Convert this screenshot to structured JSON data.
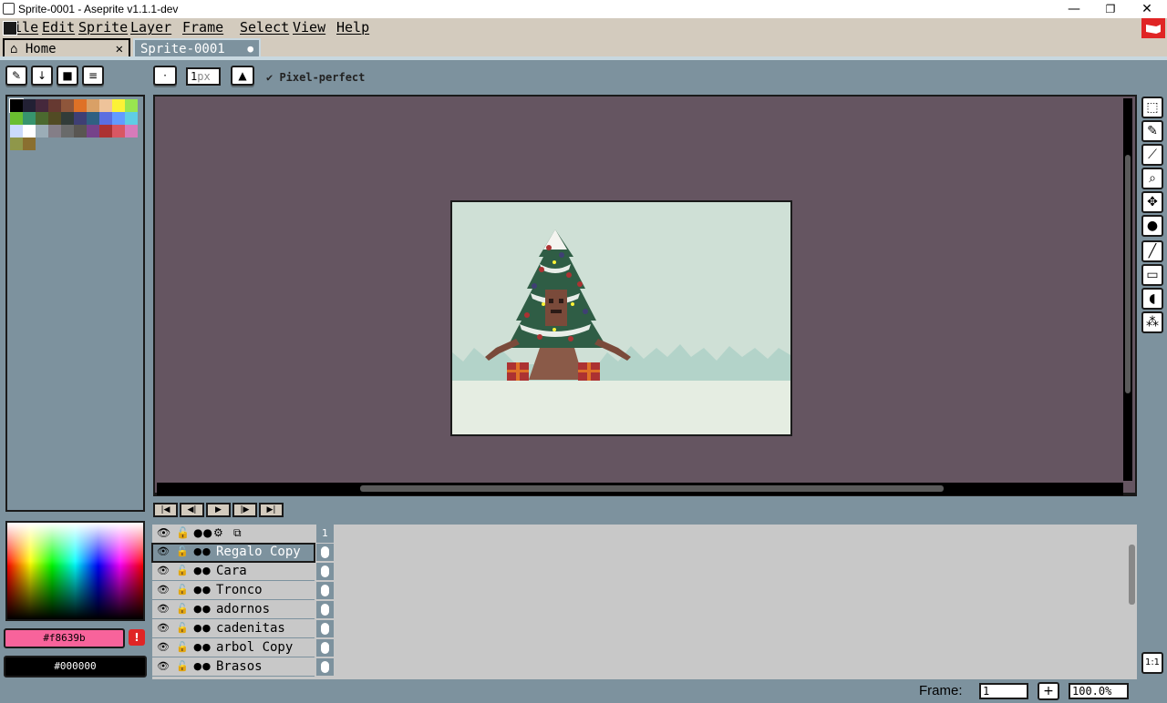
{
  "window": {
    "title": "Sprite-0001 - Aseprite v1.1.1-dev",
    "minimize": "—",
    "restore": "❐",
    "close": "✕"
  },
  "menubar": {
    "items": [
      {
        "label": "File"
      },
      {
        "label": "Edit"
      },
      {
        "label": "Sprite"
      },
      {
        "label": "Layer"
      },
      {
        "label": "Frame"
      },
      {
        "label": "Select"
      },
      {
        "label": "View"
      },
      {
        "label": "Help"
      }
    ]
  },
  "tabs": [
    {
      "label": "Home",
      "icon": "home-icon",
      "close_glyph": "✕"
    },
    {
      "label": "Sprite-0001",
      "modified_glyph": "●"
    }
  ],
  "context_bar": {
    "brush_size_value": "1",
    "brush_size_unit": "px",
    "pixel_perfect_label": "Pixel-perfect",
    "pixel_perfect_checked": true
  },
  "palette": {
    "colors": [
      "#000000",
      "#222034",
      "#45283c",
      "#663931",
      "#8f563b",
      "#df7126",
      "#d9a066",
      "#eec39a",
      "#fbf236",
      "#99e550",
      "#6abe30",
      "#37946e",
      "#4b692f",
      "#524b24",
      "#323c39",
      "#3f3f74",
      "#306082",
      "#5b6ee1",
      "#639bff",
      "#5fcde4",
      "#cbdbfc",
      "#ffffff",
      "#9badb7",
      "#847e87",
      "#696a6a",
      "#595652",
      "#76428a",
      "#ac3232",
      "#d95763",
      "#d77bba",
      "#8f974a",
      "#8a6f30"
    ],
    "selected_index": 0
  },
  "colors": {
    "foreground": "#f8639b",
    "foreground_label": "#f8639b",
    "foreground_warning": "!",
    "background": "#000000",
    "background_label": "#000000",
    "editor_bg": "#655561",
    "ui_bg": "#7d929e"
  },
  "tools": [
    "rectangular-marquee",
    "pencil",
    "eyedropper",
    "zoom",
    "move",
    "paint-bucket",
    "line",
    "rectangle",
    "contour",
    "spray"
  ],
  "playback": [
    "first-frame",
    "previous-frame",
    "play",
    "next-frame",
    "last-frame"
  ],
  "timeline": {
    "frame_header": "1",
    "layers": [
      {
        "name": "Regalo Copy",
        "active": true
      },
      {
        "name": "Cara"
      },
      {
        "name": "Tronco"
      },
      {
        "name": "adornos"
      },
      {
        "name": "cadenitas"
      },
      {
        "name": "arbol Copy"
      },
      {
        "name": "Brasos"
      }
    ]
  },
  "status": {
    "frame_label": "Frame:",
    "frame_value": "1",
    "add_frame": "+",
    "zoom_value": "100.0%",
    "actual_size": "1:1"
  }
}
